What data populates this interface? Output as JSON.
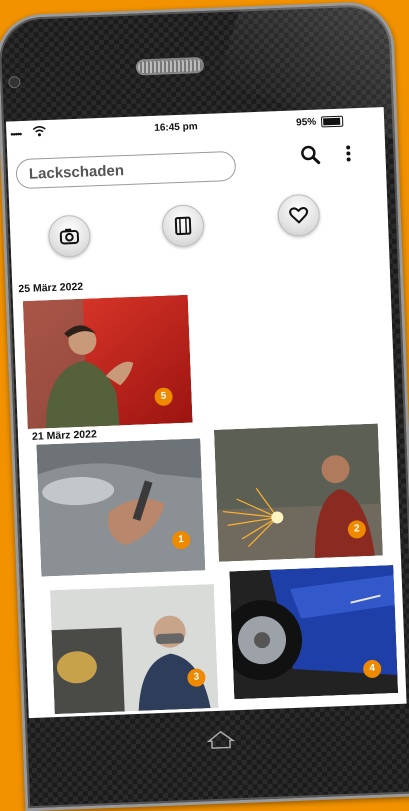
{
  "status_bar": {
    "signal": "•••••",
    "time": "16:45 pm",
    "battery_percent": "95%"
  },
  "search": {
    "value": "Lackschaden"
  },
  "toolbar": {
    "search_icon": "magnifier-icon",
    "more_icon": "vertical-dots-icon"
  },
  "filters": [
    {
      "icon": "camera-icon"
    },
    {
      "icon": "film-icon"
    },
    {
      "icon": "heart-icon"
    }
  ],
  "groups": [
    {
      "date": "25 März 2022",
      "photos": [
        {
          "badge": "5",
          "description_icon": "photo-thumbs-up-car"
        }
      ]
    },
    {
      "date": "21 März 2022",
      "photos": [
        {
          "badge": "1"
        },
        {
          "badge": "2"
        },
        {
          "badge": "3"
        },
        {
          "badge": "4"
        }
      ]
    }
  ],
  "colors": {
    "accent": "#ef8a00",
    "background": "#f29200"
  }
}
